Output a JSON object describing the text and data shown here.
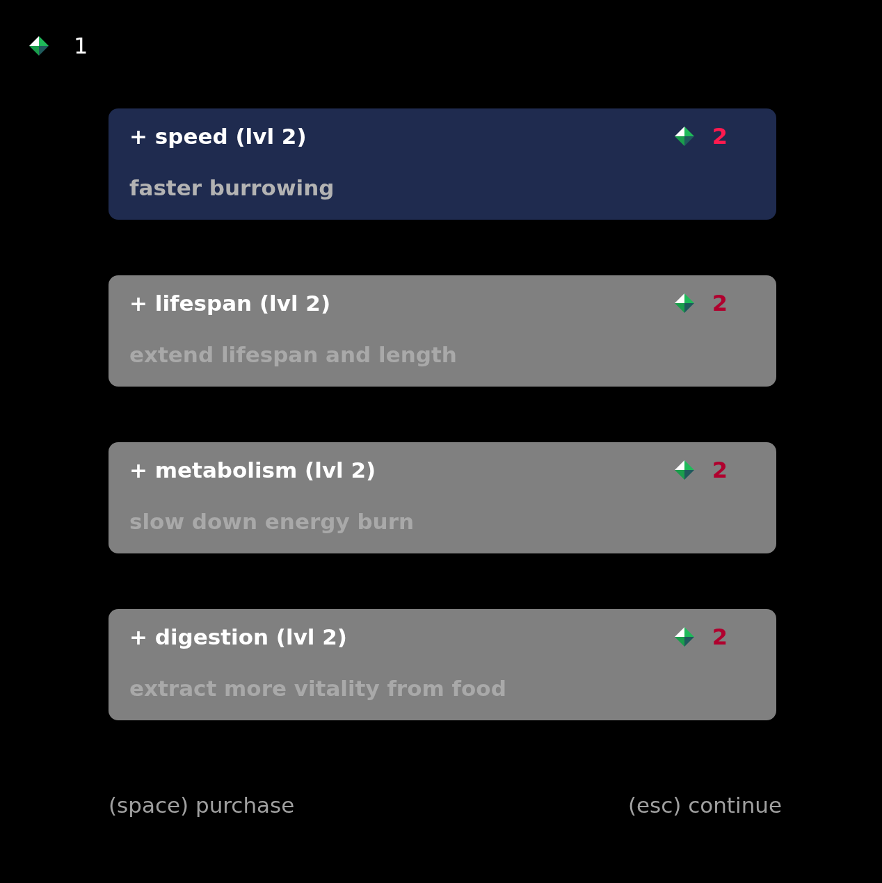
{
  "currency": {
    "amount": "1"
  },
  "upgrades": [
    {
      "title": "+ speed (lvl 2)",
      "description": "faster burrowing",
      "cost": "2",
      "selected": true
    },
    {
      "title": "+ lifespan (lvl 2)",
      "description": "extend lifespan and length",
      "cost": "2",
      "selected": false
    },
    {
      "title": "+ metabolism (lvl 2)",
      "description": "slow down energy burn",
      "cost": "2",
      "selected": false
    },
    {
      "title": "+ digestion (lvl 2)",
      "description": "extract more vitality from food",
      "cost": "2",
      "selected": false
    }
  ],
  "footer": {
    "left": "(space) purchase",
    "right": "(esc) continue"
  }
}
